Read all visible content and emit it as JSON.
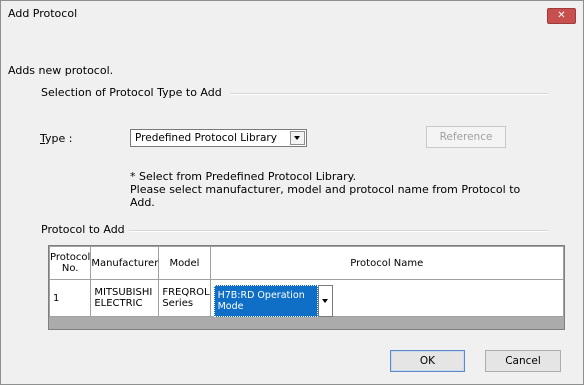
{
  "window": {
    "title": "Add Protocol",
    "close_glyph": "✕"
  },
  "intro_text": "Adds new protocol.",
  "selection_group": {
    "label": "Selection of Protocol Type to Add",
    "type_label": "Type :",
    "type_value": "Predefined Protocol Library",
    "reference_button": "Reference",
    "note_line1": "* Select from Predefined Protocol Library.",
    "note_line2": "Please select manufacturer, model and protocol name from Protocol to",
    "note_line3": "Add."
  },
  "protocol_group": {
    "label": "Protocol to Add",
    "columns": [
      "Protocol No.",
      "Manufacturer",
      "Model",
      "Protocol Name"
    ],
    "rows": [
      {
        "no": "1",
        "manufacturer": "MITSUBISHI ELECTRIC",
        "model": "FREQROL Series",
        "protocol_name": "H7B:RD Operation Mode"
      }
    ]
  },
  "buttons": {
    "ok": "OK",
    "cancel": "Cancel"
  },
  "colors": {
    "close_button": "#c7504f",
    "selection_highlight": "#0f6fc6",
    "grid_background": "#ababab"
  }
}
